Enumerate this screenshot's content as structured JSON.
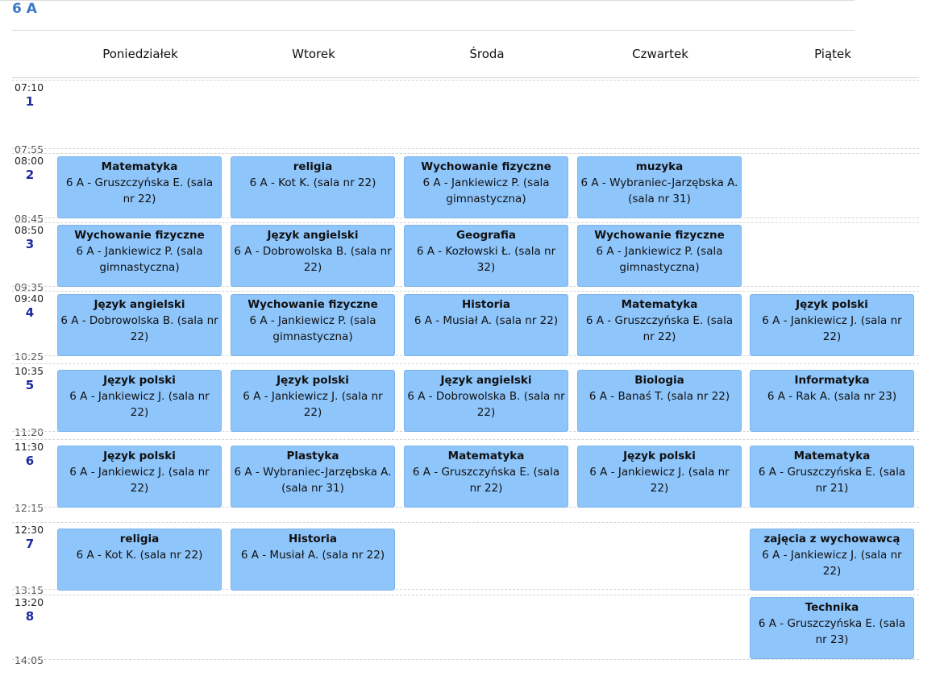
{
  "title": "6 A",
  "days": [
    "Poniedziałek",
    "Wtorek",
    "Środa",
    "Czwartek",
    "Piątek"
  ],
  "periods": [
    {
      "num": "1",
      "start": "07:10",
      "end": "07:55"
    },
    {
      "num": "2",
      "start": "08:00",
      "end": "08:45"
    },
    {
      "num": "3",
      "start": "08:50",
      "end": "09:35"
    },
    {
      "num": "4",
      "start": "09:40",
      "end": "10:25"
    },
    {
      "num": "5",
      "start": "10:35",
      "end": "11:20"
    },
    {
      "num": "6",
      "start": "11:30",
      "end": "12:15"
    },
    {
      "num": "7",
      "start": "12:30",
      "end": "13:15"
    },
    {
      "num": "8",
      "start": "13:20",
      "end": "14:05"
    }
  ],
  "lessons": [
    {
      "day": 0,
      "period": 2,
      "subject": "Matematyka",
      "details": "6 A - Gruszczyńska E. (sala nr 22)"
    },
    {
      "day": 1,
      "period": 2,
      "subject": "religia",
      "details": "6 A - Kot K. (sala nr 22)"
    },
    {
      "day": 2,
      "period": 2,
      "subject": "Wychowanie fizyczne",
      "details": "6 A - Jankiewicz P. (sala gimnastyczna)"
    },
    {
      "day": 3,
      "period": 2,
      "subject": "muzyka",
      "details": "6 A - Wybraniec-Jarzębska A. (sala nr 31)"
    },
    {
      "day": 0,
      "period": 3,
      "subject": "Wychowanie fizyczne",
      "details": "6 A - Jankiewicz P. (sala gimnastyczna)"
    },
    {
      "day": 1,
      "period": 3,
      "subject": "Język angielski",
      "details": "6 A - Dobrowolska B. (sala nr 22)"
    },
    {
      "day": 2,
      "period": 3,
      "subject": "Geografia",
      "details": "6 A - Kozłowski Ł. (sala nr 32)"
    },
    {
      "day": 3,
      "period": 3,
      "subject": "Wychowanie fizyczne",
      "details": "6 A - Jankiewicz P. (sala gimnastyczna)"
    },
    {
      "day": 0,
      "period": 4,
      "subject": "Język angielski",
      "details": "6 A - Dobrowolska B. (sala nr 22)"
    },
    {
      "day": 1,
      "period": 4,
      "subject": "Wychowanie fizyczne",
      "details": "6 A - Jankiewicz P. (sala gimnastyczna)"
    },
    {
      "day": 2,
      "period": 4,
      "subject": "Historia",
      "details": "6 A - Musiał A. (sala nr 22)"
    },
    {
      "day": 3,
      "period": 4,
      "subject": "Matematyka",
      "details": "6 A - Gruszczyńska E. (sala nr 22)"
    },
    {
      "day": 4,
      "period": 4,
      "subject": "Język polski",
      "details": "6 A - Jankiewicz J. (sala nr 22)"
    },
    {
      "day": 0,
      "period": 5,
      "subject": "Język polski",
      "details": "6 A - Jankiewicz J. (sala nr 22)"
    },
    {
      "day": 1,
      "period": 5,
      "subject": "Język polski",
      "details": "6 A - Jankiewicz J. (sala nr 22)"
    },
    {
      "day": 2,
      "period": 5,
      "subject": "Język angielski",
      "details": "6 A - Dobrowolska B. (sala nr 22)"
    },
    {
      "day": 3,
      "period": 5,
      "subject": "Biologia",
      "details": "6 A - Banaś T. (sala nr 22)"
    },
    {
      "day": 4,
      "period": 5,
      "subject": "Informatyka",
      "details": "6 A - Rak A. (sala nr 23)"
    },
    {
      "day": 0,
      "period": 6,
      "subject": "Język polski",
      "details": "6 A - Jankiewicz J. (sala nr 22)"
    },
    {
      "day": 1,
      "period": 6,
      "subject": "Plastyka",
      "details": "6 A - Wybraniec-Jarzębska A. (sala nr 31)"
    },
    {
      "day": 2,
      "period": 6,
      "subject": "Matematyka",
      "details": "6 A - Gruszczyńska E. (sala nr 22)"
    },
    {
      "day": 3,
      "period": 6,
      "subject": "Język polski",
      "details": "6 A - Jankiewicz J. (sala nr 22)"
    },
    {
      "day": 4,
      "period": 6,
      "subject": "Matematyka",
      "details": "6 A - Gruszczyńska E. (sala nr 21)"
    },
    {
      "day": 0,
      "period": 7,
      "subject": "religia",
      "details": "6 A - Kot K. (sala nr 22)"
    },
    {
      "day": 1,
      "period": 7,
      "subject": "Historia",
      "details": "6 A - Musiał A. (sala nr 22)"
    },
    {
      "day": 4,
      "period": 7,
      "subject": "zajęcia z wychowawcą",
      "details": "6 A - Jankiewicz J. (sala nr 22)"
    },
    {
      "day": 4,
      "period": 8,
      "subject": "Technika",
      "details": "6 A - Gruszczyńska E. (sala nr 23)"
    }
  ],
  "colors": {
    "lesson_bg": "#8ec5fb",
    "title": "#3a7bc8",
    "period_num": "#1c2a9e"
  }
}
